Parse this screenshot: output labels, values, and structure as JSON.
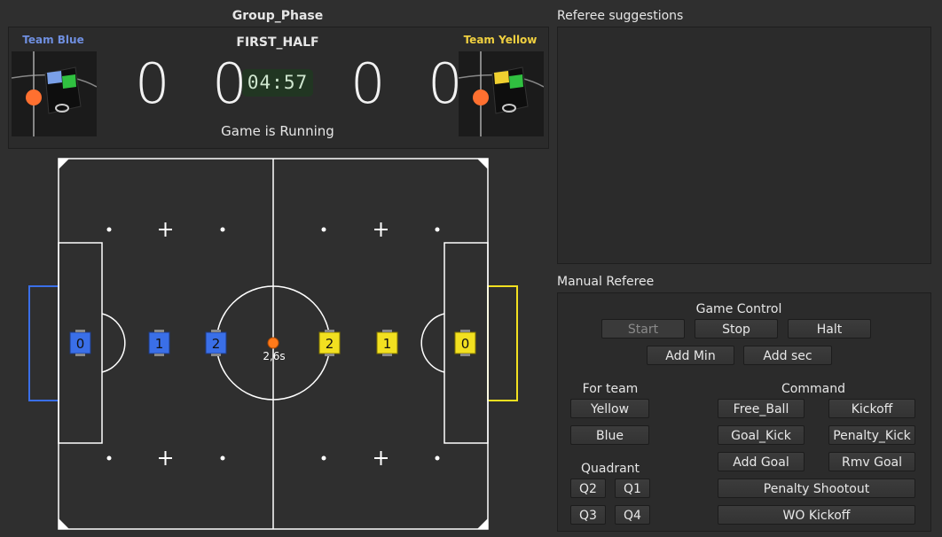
{
  "header": {
    "phase": "Group_Phase",
    "half": "FIRST_HALF",
    "timer": "04:57",
    "status": "Game is Running",
    "blue": {
      "name": "Team Blue",
      "score": "0 0",
      "color": "#6f8fe0"
    },
    "yellow": {
      "name": "Team Yellow",
      "score": "0 0",
      "color": "#f0d040"
    }
  },
  "field": {
    "ball_label": "2,6s",
    "blue_robots": [
      "0",
      "1",
      "2"
    ],
    "yellow_robots": [
      "2",
      "1",
      "0"
    ],
    "colors": {
      "blue": "#3a6fe8",
      "yellow": "#f2e020",
      "ball": "#ff7a1a",
      "line": "#ffffff"
    }
  },
  "referee_suggestions": {
    "title": "Referee suggestions"
  },
  "manual_referee": {
    "title": "Manual Referee",
    "game_control": {
      "title": "Game Control",
      "start": "Start",
      "stop": "Stop",
      "halt": "Halt",
      "add_min": "Add Min",
      "add_sec": "Add sec"
    },
    "for_team": {
      "title": "For team",
      "yellow": "Yellow",
      "blue": "Blue"
    },
    "quadrant": {
      "title": "Quadrant",
      "q1": "Q1",
      "q2": "Q2",
      "q3": "Q3",
      "q4": "Q4"
    },
    "command": {
      "title": "Command",
      "free_ball": "Free_Ball",
      "kickoff": "Kickoff",
      "goal_kick": "Goal_Kick",
      "penalty_kick": "Penalty_Kick",
      "add_goal": "Add Goal",
      "rmv_goal": "Rmv Goal",
      "penalty_shootout": "Penalty Shootout",
      "wo_kickoff": "WO Kickoff"
    }
  }
}
